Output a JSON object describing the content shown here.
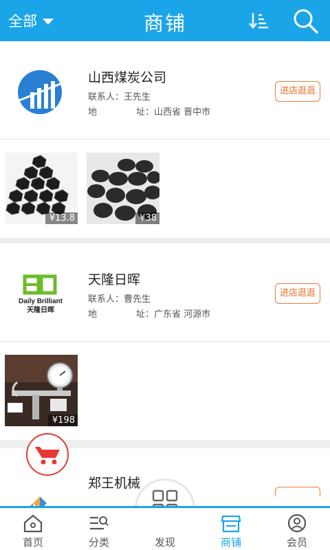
{
  "header": {
    "filter_label": "全部",
    "title": "商铺",
    "sort_icon": "sort-descending-icon",
    "search_icon": "search-icon"
  },
  "shops": [
    {
      "name": "山西煤炭公司",
      "contact_key": "联系人：",
      "contact": "王先生",
      "addr_key1": "地",
      "addr_key2": "址：",
      "address": "山西省 晋中市",
      "visit_label": "进店逛逛",
      "products": [
        {
          "price": "¥13.8"
        },
        {
          "price": "¥38"
        }
      ]
    },
    {
      "name": "天隆日晖",
      "logo_text_en": "Daily Brilliant",
      "logo_text_cn": "天隆日晖",
      "contact_key": "联系人：",
      "contact": "曹先生",
      "addr_key1": "地",
      "addr_key2": "址：",
      "address": "广东省 河源市",
      "visit_label": "进店逛逛",
      "products": [
        {
          "price": "¥198"
        }
      ]
    },
    {
      "name": "郑王机械"
    }
  ],
  "tabbar": {
    "items": [
      {
        "label": "首页",
        "icon": "home-icon"
      },
      {
        "label": "分类",
        "icon": "category-icon"
      },
      {
        "label": "发现",
        "icon": "grid-icon"
      },
      {
        "label": "商铺",
        "icon": "shop-icon"
      },
      {
        "label": "会员",
        "icon": "user-icon"
      }
    ],
    "active": "商铺"
  },
  "colors": {
    "primary": "#1aa5e8",
    "accent": "#f06a22",
    "cart_red": "#e53935"
  }
}
